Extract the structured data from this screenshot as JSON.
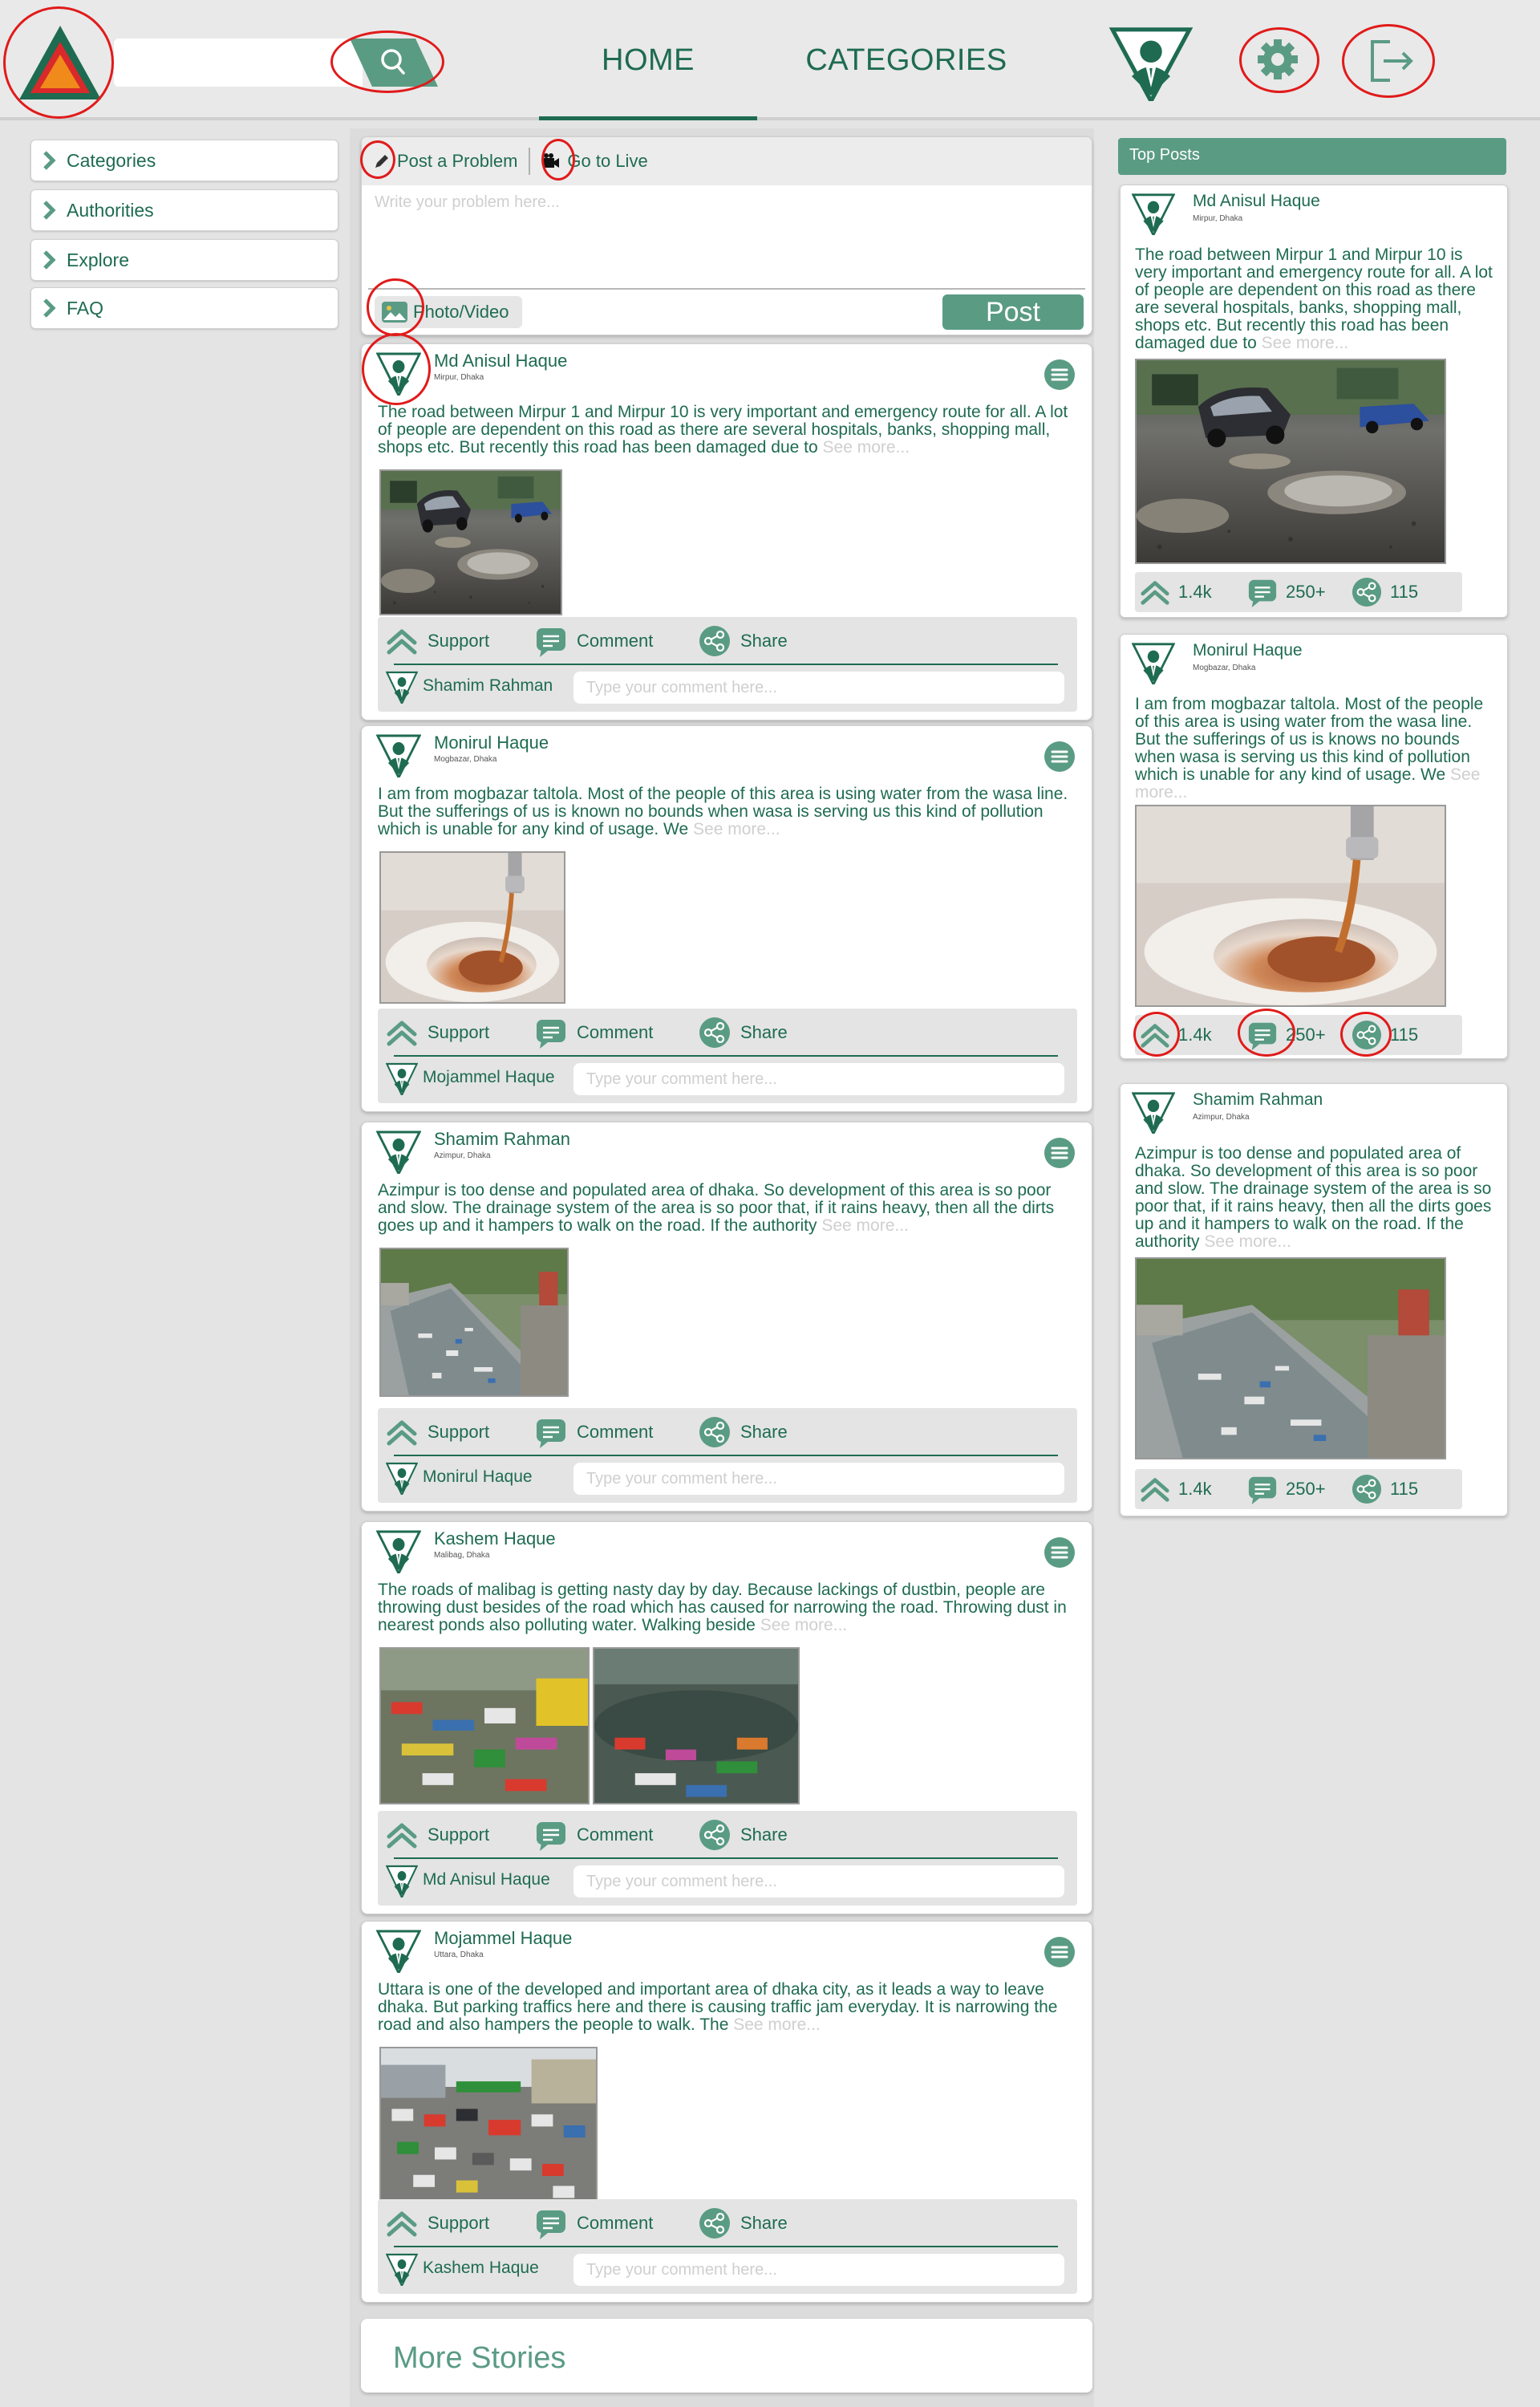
{
  "header": {
    "search_placeholder": "",
    "tabs": [
      "HOME",
      "CATEGORIES"
    ],
    "active_tab": "HOME"
  },
  "sidebar": {
    "items": [
      {
        "label": "Categories",
        "icon": "chevron-right-icon"
      },
      {
        "label": "Authorities",
        "icon": "chevron-right-icon"
      },
      {
        "label": "Explore",
        "icon": "chevron-right-icon"
      },
      {
        "label": "FAQ",
        "icon": "chevron-right-icon"
      }
    ]
  },
  "composer": {
    "post_problem_label": "Post a Problem",
    "go_live_label": "Go to Live",
    "placeholder": "Write your problem here...",
    "photo_video_label": "Photo/Video",
    "post_button_label": "Post"
  },
  "actions": {
    "support": "Support",
    "comment": "Comment",
    "share": "Share"
  },
  "comment_placeholder": "Type your comment here...",
  "posts": [
    {
      "author": "Md Anisul Haque",
      "location": "Mirpur, Dhaka",
      "text": "The road between Mirpur 1 and Mirpur 10 is very important and emergency route for all. A lot of people are dependent on this road as there are several hospitals, banks, shopping mall, shops etc. But recently this road has been damaged due to",
      "see_more": "See more...",
      "image": "damaged road with potholes and water",
      "commenter": "Shamim Rahman"
    },
    {
      "author": "Monirul Haque",
      "location": "Mogbazar, Dhaka",
      "text": "I am from mogbazar taltola. Most of the people of this area is using water from the wasa line. But the sufferings of us is known no bounds when wasa is serving us this kind of pollution which is unable for any kind of usage. We",
      "see_more": "See more...",
      "image": "dirty brown tap water",
      "commenter": "Mojammel Haque"
    },
    {
      "author": "Shamim Rahman",
      "location": "Azimpur, Dhaka",
      "text": "Azimpur is too dense and populated area of dhaka. So development of this area is so poor and slow. The drainage system of the area is so poor that, if it rains heavy, then all the dirts goes up and it hampers to walk on the road. If the authority",
      "see_more": "See more...",
      "image": "garbage-filled drainage canal",
      "commenter": "Monirul Haque"
    },
    {
      "author": "Kashem Haque",
      "location": "Malibag, Dhaka",
      "text": "The roads of malibag is getting nasty day by day. Because lackings of dustbin, people are throwing dust besides of the road which has caused for narrowing the road. Throwing dust in nearest ponds also polluting water. Walking beside",
      "see_more": "See more...",
      "image": "garbage on road and in pond",
      "commenter": "Md Anisul Haque"
    },
    {
      "author": "Mojammel Haque",
      "location": "Uttara, Dhaka",
      "text": "Uttara is one of the developed and important area of dhaka city, as it leads a way to leave dhaka. But parking traffics here and there is causing traffic jam everyday. It is narrowing the road and also hampers the people to walk. The",
      "see_more": "See more...",
      "image": "traffic jam",
      "commenter": "Kashem Haque"
    }
  ],
  "more_stories_label": "More Stories",
  "top_posts": {
    "title": "Top Posts",
    "items": [
      {
        "author": "Md Anisul Haque",
        "location": "Mirpur, Dhaka",
        "text": "The road between Mirpur 1 and Mirpur 10 is very important and emergency route for all. A lot of people are dependent on this road as there are several hospitals, banks, shopping mall, shops etc. But recently this road has been damaged due to",
        "see_more": "See more...",
        "supports": "1.4k",
        "comments": "250+",
        "shares": "115"
      },
      {
        "author": "Monirul Haque",
        "location": "Mogbazar, Dhaka",
        "text": "I am from mogbazar taltola. Most of the people of this area is using water from the wasa line. But the sufferings of us is knows no bounds when wasa is serving us this kind of pollution which is unable for any kind of usage. We",
        "see_more": "See more...",
        "supports": "1.4k",
        "comments": "250+",
        "shares": "115"
      },
      {
        "author": "Shamim Rahman",
        "location": "Azimpur, Dhaka",
        "text": "Azimpur is too dense and populated area of dhaka. So development of this area is so poor and slow. The drainage system of the area is so poor that, if it rains heavy, then all the dirts goes up and it hampers to walk on the road. If the authority",
        "see_more": "See more...",
        "supports": "1.4k",
        "comments": "250+",
        "shares": "115"
      }
    ]
  },
  "colors": {
    "accent": "#1e6b52",
    "accent_light": "#5a9b84",
    "background": "#e4e4e4",
    "annotation": "#e11a1a"
  }
}
